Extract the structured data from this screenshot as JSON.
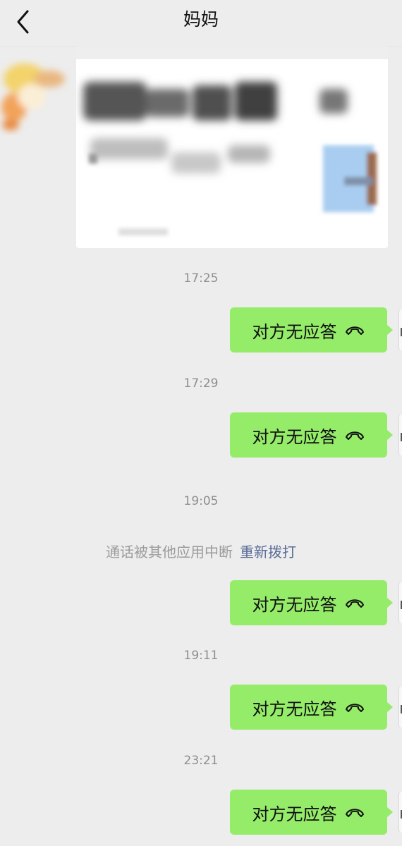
{
  "header": {
    "title": "妈妈"
  },
  "messages": [
    {
      "time": "17:25",
      "text": "对方无应答"
    },
    {
      "time": "17:29",
      "text": "对方无应答"
    },
    {
      "time": "19:05",
      "system": "通话被其他应用中断",
      "system_link": "重新拨打",
      "text": "对方无应答"
    },
    {
      "time": "19:11",
      "text": "对方无应答"
    },
    {
      "time": "23:21",
      "text": "对方无应答"
    }
  ],
  "colors": {
    "background": "#ededed",
    "bubble": "#95ec69",
    "link": "#576b95",
    "timestamp": "#8e8e8e"
  },
  "icons": {
    "back": "chevron-left-icon",
    "call": "phone-hangup-icon"
  }
}
